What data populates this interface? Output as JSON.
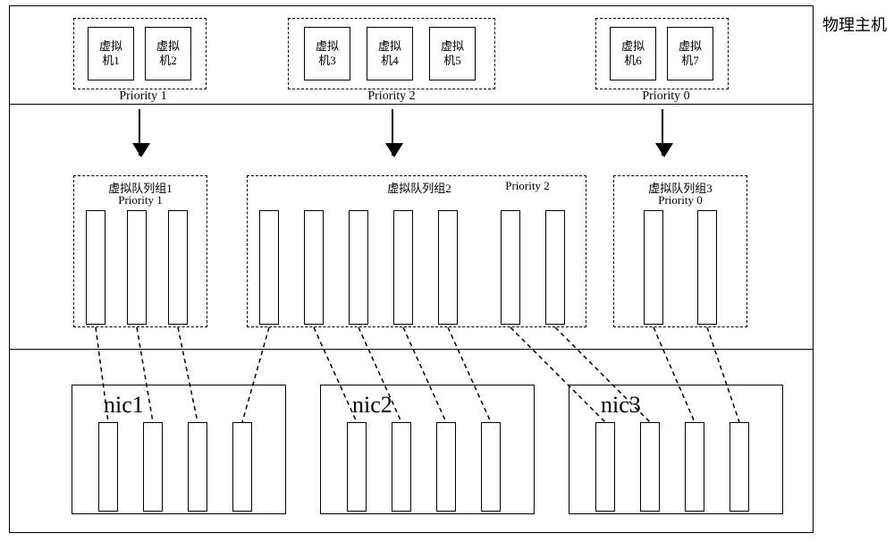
{
  "host_label": "物理主机",
  "groups": {
    "g1": {
      "priority_label": "Priority 1",
      "vms": [
        "虚拟\n机1",
        "虚拟\n机2"
      ]
    },
    "g2": {
      "priority_label": "Priority 2",
      "vms": [
        "虚拟\n机3",
        "虚拟\n机4",
        "虚拟\n机5"
      ]
    },
    "g3": {
      "priority_label": "Priority 0",
      "vms": [
        "虚拟\n机6",
        "虚拟\n机7"
      ]
    }
  },
  "qgroups": {
    "q1": {
      "name": "虚拟队列组1",
      "priority": "Priority 1"
    },
    "q2": {
      "name": "虚拟队列组2",
      "priority": "Priority 2"
    },
    "q3": {
      "name": "虚拟队列组3",
      "priority": "Priority 0"
    }
  },
  "nics": {
    "n1": "nic1",
    "n2": "nic2",
    "n3": "nic3"
  },
  "chart_data": {
    "type": "diagram",
    "title": "物理主机",
    "vm_priority_groups": [
      {
        "priority": 1,
        "vms": [
          "虚拟机1",
          "虚拟机2"
        ]
      },
      {
        "priority": 2,
        "vms": [
          "虚拟机3",
          "虚拟机4",
          "虚拟机5"
        ]
      },
      {
        "priority": 0,
        "vms": [
          "虚拟机6",
          "虚拟机7"
        ]
      }
    ],
    "virtual_queue_groups": [
      {
        "name": "虚拟队列组1",
        "priority": 1,
        "queues": 3
      },
      {
        "name": "虚拟队列组2",
        "priority": 2,
        "queues": 7
      },
      {
        "name": "虚拟队列组3",
        "priority": 0,
        "queues": 2
      }
    ],
    "nics": [
      {
        "name": "nic1",
        "physical_queues": 4
      },
      {
        "name": "nic2",
        "physical_queues": 4
      },
      {
        "name": "nic3",
        "physical_queues": 4
      }
    ],
    "mappings_vq_to_nic": [
      {
        "vq_group": "虚拟队列组1",
        "vq_index": 0,
        "nic": "nic1",
        "pq_index": 0
      },
      {
        "vq_group": "虚拟队列组1",
        "vq_index": 1,
        "nic": "nic1",
        "pq_index": 1
      },
      {
        "vq_group": "虚拟队列组1",
        "vq_index": 2,
        "nic": "nic1",
        "pq_index": 2
      },
      {
        "vq_group": "虚拟队列组2",
        "vq_index": 0,
        "nic": "nic1",
        "pq_index": 3
      },
      {
        "vq_group": "虚拟队列组2",
        "vq_index": 1,
        "nic": "nic2",
        "pq_index": 0
      },
      {
        "vq_group": "虚拟队列组2",
        "vq_index": 2,
        "nic": "nic2",
        "pq_index": 1
      },
      {
        "vq_group": "虚拟队列组2",
        "vq_index": 3,
        "nic": "nic2",
        "pq_index": 2
      },
      {
        "vq_group": "虚拟队列组2",
        "vq_index": 4,
        "nic": "nic2",
        "pq_index": 3
      },
      {
        "vq_group": "虚拟队列组2",
        "vq_index": 5,
        "nic": "nic3",
        "pq_index": 0
      },
      {
        "vq_group": "虚拟队列组2",
        "vq_index": 6,
        "nic": "nic3",
        "pq_index": 1
      },
      {
        "vq_group": "虚拟队列组3",
        "vq_index": 0,
        "nic": "nic3",
        "pq_index": 2
      },
      {
        "vq_group": "虚拟队列组3",
        "vq_index": 1,
        "nic": "nic3",
        "pq_index": 3
      }
    ]
  }
}
